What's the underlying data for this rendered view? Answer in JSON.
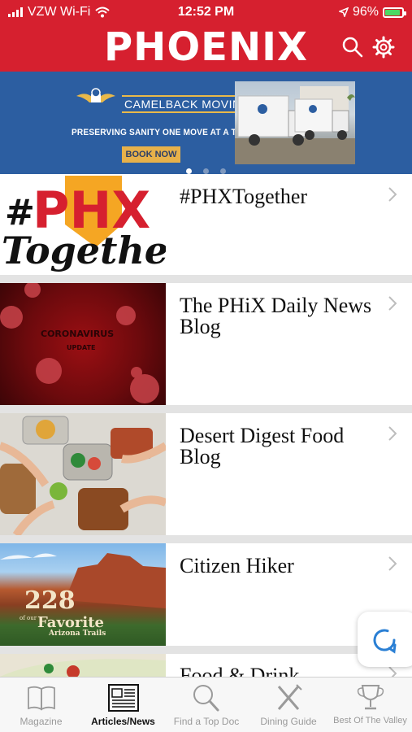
{
  "status_bar": {
    "carrier": "VZW Wi-Fi",
    "time": "12:52 PM",
    "battery": "96%"
  },
  "header": {
    "title": "PHOENIX",
    "search_icon": "search-icon",
    "settings_icon": "gear-icon",
    "color": "#d6202f"
  },
  "banner": {
    "brand": "CAMELBACK MOVING",
    "tagline": "PRESERVING SANITY ONE MOVE AT A TIME",
    "button": "BOOK NOW",
    "page_count": 3,
    "active_page": 1,
    "color": "#2c5ea1"
  },
  "list": {
    "items": [
      {
        "label": "#PHXTogether",
        "thumb_text_1": "#PHX",
        "thumb_text_2": "Together"
      },
      {
        "label": "The PHiX Daily News Blog",
        "thumb_text_1": "CORONAVIRUS",
        "thumb_text_2": "UPDATE"
      },
      {
        "label": "Desert Digest Food Blog"
      },
      {
        "label": "Citizen Hiker",
        "thumb_text_1": "228",
        "thumb_text_2": "Favorite",
        "thumb_text_3": "Arizona Trails",
        "thumb_text_4": "of our"
      },
      {
        "label": "Food & Drink"
      }
    ]
  },
  "fab": {
    "icon": "refresh-icon"
  },
  "tabbar": {
    "tabs": [
      {
        "label": "Magazine",
        "icon": "book-icon",
        "active": false
      },
      {
        "label": "Articles/News",
        "icon": "newspaper-icon",
        "active": true
      },
      {
        "label": "Find a Top Doc",
        "icon": "magnifier-icon",
        "active": false
      },
      {
        "label": "Dining Guide",
        "icon": "fork-knife-icon",
        "active": false
      },
      {
        "label": "Best Of The Valley",
        "icon": "trophy-icon",
        "active": false
      }
    ]
  }
}
